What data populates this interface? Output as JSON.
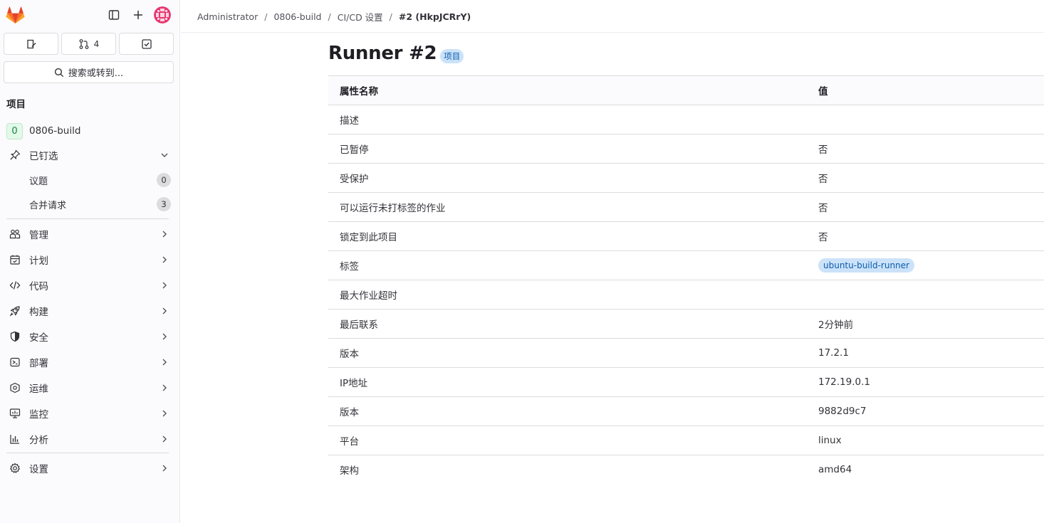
{
  "sidebar": {
    "merge_request_count": "4",
    "search_label": "搜索或转到...",
    "section_title": "项目",
    "project": {
      "initial": "0",
      "name": "0806-build"
    },
    "pinned": {
      "label": "已钉选",
      "items": [
        {
          "label": "议题",
          "count": "0"
        },
        {
          "label": "合并请求",
          "count": "3"
        }
      ]
    },
    "nav": [
      {
        "label": "管理",
        "icon": "users-icon"
      },
      {
        "label": "计划",
        "icon": "calendar-icon"
      },
      {
        "label": "代码",
        "icon": "code-icon"
      },
      {
        "label": "构建",
        "icon": "rocket-icon"
      },
      {
        "label": "安全",
        "icon": "shield-icon"
      },
      {
        "label": "部署",
        "icon": "deploy-icon"
      },
      {
        "label": "运维",
        "icon": "operate-icon"
      },
      {
        "label": "监控",
        "icon": "monitor-icon"
      },
      {
        "label": "分析",
        "icon": "chart-icon"
      }
    ],
    "settings_label": "设置"
  },
  "breadcrumb": [
    "Administrator",
    "0806-build",
    "CI/CD 设置",
    "#2 (HkpJCRrY)"
  ],
  "page": {
    "title": "Runner #2",
    "scope_badge": "项目"
  },
  "table": {
    "headers": [
      "属性名称",
      "值"
    ],
    "rows": [
      {
        "name": "描述",
        "value": ""
      },
      {
        "name": "已暂停",
        "value": "否"
      },
      {
        "name": "受保护",
        "value": "否"
      },
      {
        "name": "可以运行未打标签的作业",
        "value": "否"
      },
      {
        "name": "锁定到此项目",
        "value": "否"
      },
      {
        "name": "标签",
        "value": "ubuntu-build-runner",
        "is_tag": true
      },
      {
        "name": "最大作业超时",
        "value": ""
      },
      {
        "name": "最后联系",
        "value": "2分钟前"
      },
      {
        "name": "版本",
        "value": "17.2.1"
      },
      {
        "name": "IP地址",
        "value": "172.19.0.1"
      },
      {
        "name": "版本",
        "value": "9882d9c7"
      },
      {
        "name": "平台",
        "value": "linux"
      },
      {
        "name": "架构",
        "value": "amd64"
      }
    ]
  },
  "colors": {
    "badge_bg": "#cbe2f9",
    "badge_text": "#0b5cad",
    "project_badge_bg": "#e3fae8",
    "project_badge_text": "#108548"
  }
}
